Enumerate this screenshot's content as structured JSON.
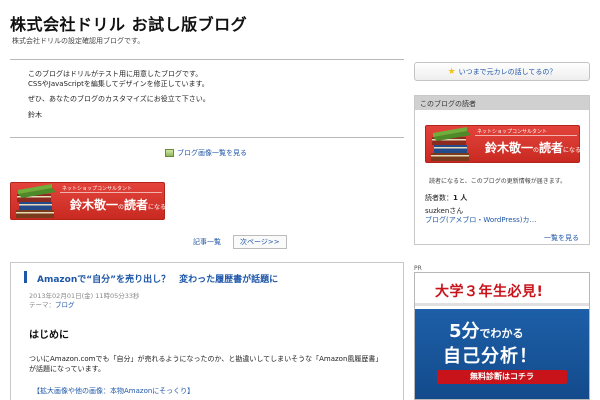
{
  "header": {
    "title": "株式会社ドリル お試し版ブログ",
    "description": "株式会社ドリルの設定確認用ブログです。"
  },
  "intro": {
    "line1": "このブログはドリルがテスト用に用意したブログです。",
    "line2": "CSSやJavaScriptを編集してデザインを修正しています。",
    "line3": "ぜひ、あなたのブログのカスタマイズにお役立て下さい。",
    "signature": "鈴木"
  },
  "image_list_link": "ブログ画像一覧を見る",
  "banner": {
    "subtitle": "ネットショップコンサルタント",
    "name": "鈴木敬一",
    "suffix_no": "の",
    "readers_label": "読者",
    "suffix_ni": "になる"
  },
  "pager": {
    "list": "記事一覧",
    "next": "次ページ>>"
  },
  "article": {
    "title": "Amazonで“自分”を売り出し？　変わった履歴書が話題に",
    "date": "2013年02月01日(金) 11時05分33秒",
    "theme_label": "テーマ：",
    "theme": "ブログ",
    "heading": "はじめに",
    "body_line1": "ついにAmazon.comでも「自分」が売れるようになったのか、と勘違いしてしまいそうな「Amazon風履歴書」",
    "body_line2": "が話題になっています。",
    "link": "【拡大画像や他の画像：本物Amazonにそっくり】"
  },
  "sidebar": {
    "button_label": "いつまで元カレの話してるの？",
    "readers": {
      "heading": "このブログの読者",
      "note": "読者になると、このブログの更新情報が届きます。",
      "count_label": "読者数：",
      "count": "1 人",
      "user": "suzkenさん",
      "user_blog": "ブログ(アメブロ・WordPress)カ…",
      "more": "一覧を見る"
    },
    "pr": "PR",
    "ad": {
      "top": "大学３年生必見!",
      "line1_big": "5分",
      "line1_small": "でわかる",
      "line2": "自己分析！",
      "cta": "無料診断はコチラ"
    }
  },
  "colors": {
    "link": "#1f57a8",
    "banner_red": "#c82a22",
    "ad_blue": "#1d5fa8",
    "ad_red": "#c8131b"
  }
}
